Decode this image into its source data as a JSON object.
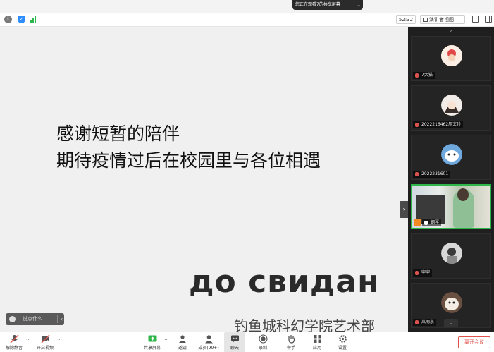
{
  "banner": {
    "text": "您正在观看7的共享屏幕",
    "close": "⌄"
  },
  "topbar": {
    "info_icon": "info-icon",
    "timer": "52:32",
    "view_label": "演讲者视图"
  },
  "slide": {
    "line1": "感谢短暂的陪伴",
    "line2": "期待疫情过后在校园里与各位相遇",
    "farewell": "до свидан",
    "department": "钓鱼城科幻学院艺术部"
  },
  "chat_input": {
    "placeholder": "说点什么..."
  },
  "gallery": {
    "tiles": [
      {
        "name": "7大猫",
        "muted": true
      },
      {
        "name": "2022216462周文玲",
        "muted": true
      },
      {
        "name": "2022231601",
        "muted": true
      },
      {
        "name": "钢琴",
        "muted": false
      },
      {
        "name": "宇宇",
        "muted": true
      },
      {
        "name": "岚雨泉",
        "muted": true
      }
    ]
  },
  "toolbar": {
    "unmute": "解除静音",
    "start_video": "开启视频",
    "share_screen": "共享屏幕",
    "invite": "邀请",
    "participants": "成员(99+)",
    "chat": "聊天",
    "record": "录制",
    "raise_hand": "举手",
    "apps": "应用",
    "settings": "设置",
    "end_meeting": "离开会议"
  },
  "colors": {
    "accent_green": "#2fb64a",
    "end_red": "#e0514a",
    "share_green": "#2fb64a"
  }
}
